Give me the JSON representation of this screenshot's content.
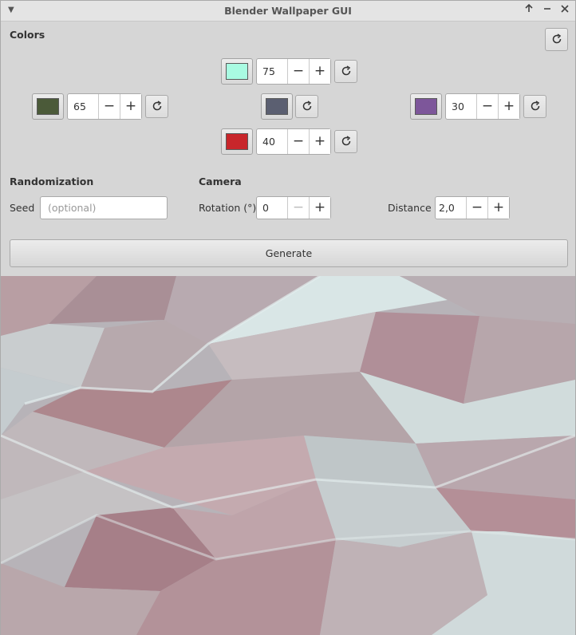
{
  "window": {
    "title": "Blender Wallpaper GUI",
    "menu_icon": "triangle-down-icon",
    "buttons": [
      "arrow-up-icon",
      "minimize-icon",
      "close-icon"
    ]
  },
  "colors": {
    "heading": "Colors",
    "top": {
      "swatch": "#a9fbe2",
      "value": "75"
    },
    "left": {
      "swatch": "#4b5a39",
      "value": "65"
    },
    "center": {
      "swatch": "#5b5f71"
    },
    "right": {
      "swatch": "#7d569a",
      "value": "30"
    },
    "bottom": {
      "swatch": "#c8262b",
      "value": "40"
    }
  },
  "randomization": {
    "heading": "Randomization",
    "seed_label": "Seed",
    "seed_value": "",
    "seed_placeholder": "(optional)"
  },
  "camera": {
    "heading": "Camera",
    "rotation_label": "Rotation (°)",
    "rotation_value": "0",
    "distance_label": "Distance",
    "distance_value": "2,0"
  },
  "generate_label": "Generate",
  "preview": {
    "description_icon": "low-poly-wallpaper-preview"
  }
}
